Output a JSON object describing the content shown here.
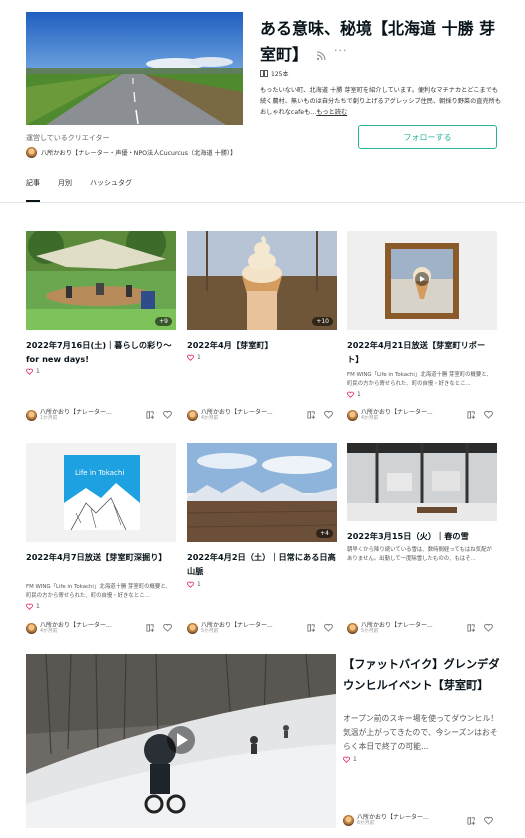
{
  "magazine": {
    "title": "ある意味、秘境【北海道 十勝 芽室町】",
    "more": "···",
    "article_count": "125本",
    "description": "もったいない町、北海道 十勝 芽室町を紹介しています。便利なマチナカとどこまでも続く農村、無いものは自分たちで創り上げるアグレッシブ住民、朝採り野菜の直売所もおしゃれなcafeも...",
    "more_link": "もっと読む",
    "creator_label": "運営しているクリエイター",
    "creator_name": "八所かおり【ナレーター・声優・NPO法人Cucurcus（北海道 十勝）】",
    "follow_label": "フォローする",
    "accent_color": "#29b399"
  },
  "tabs": [
    {
      "label": "記事",
      "active": true
    },
    {
      "label": "月別",
      "active": false
    },
    {
      "label": "ハッシュタグ",
      "active": false
    }
  ],
  "cards": [
    {
      "title": "2022年7月16日(土)｜暮らしの彩り〜for new days!",
      "excerpt": "",
      "likes": "1",
      "badge": "+9",
      "author": "八所かおり【ナレーター...",
      "date": "1か月前"
    },
    {
      "title": "2022年4月【芽室町】",
      "excerpt": "",
      "likes": "1",
      "badge": "+10",
      "author": "八所かおり【ナレーター...",
      "date": "4か月前"
    },
    {
      "title": "2022年4月21日放送【芽室町リポート】",
      "excerpt": "FM WING「Life in Tokachi」北海道十勝 芽室町の概要と、町民の方から寄せられた、町の自慢・好きなとこ...",
      "likes": "1",
      "badge": "",
      "author": "八所かおり【ナレーター...",
      "date": "4か月前"
    },
    {
      "title": "2022年4月7日放送【芽室町深掘り】",
      "excerpt": "FM WING「Life in Tokachi」北海道十勝 芽室町の概要と、町民の方から寄せられた、町の自慢・好きなとこ...",
      "likes": "1",
      "badge": "",
      "author": "八所かおり【ナレーター...",
      "date": "4か月前",
      "thumb_text": "Life in Tokachi"
    },
    {
      "title": "2022年4月2日（土）｜日常にある日高山脈",
      "excerpt": "",
      "likes": "1",
      "badge": "+4",
      "author": "八所かおり【ナレーター...",
      "date": "5か月前"
    },
    {
      "title": "2022年3月15日（火）｜春の雪",
      "excerpt": "朝早くから降り続いている雪は、数時間経ってもはね気配がありません。出勤して一度除雪したものの、もはそ...",
      "likes": "",
      "badge": "",
      "author": "八所かおり【ナレーター...",
      "date": "5か月前"
    }
  ],
  "big_card": {
    "title": "【ファットバイク】グレンデダウンヒルイベント【芽室町】",
    "excerpt": "オープン前のスキー場を使ってダウンヒル！気温が上がってきたので、今シーズンはおそらく本日で終了の可能...",
    "likes": "1",
    "author": "八所かおり【ナレーター...",
    "date": "6か月前"
  }
}
